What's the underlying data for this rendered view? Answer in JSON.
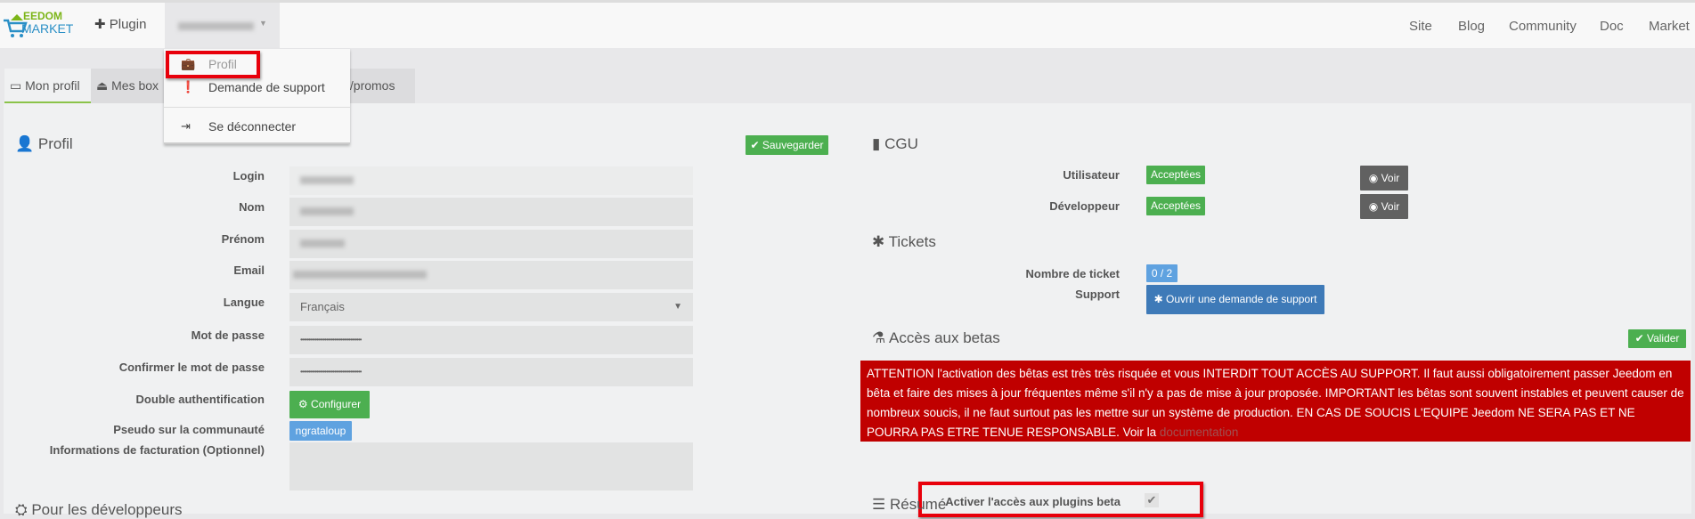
{
  "navbar": {
    "logo_text_top": "EEDOM",
    "logo_text_bottom": "MARKET",
    "plugin": "Plugin",
    "right_links": [
      "Site",
      "Blog",
      "Community",
      "Doc",
      "Market"
    ]
  },
  "user_menu": {
    "items": [
      {
        "label": "Profil",
        "icon": "briefcase-icon"
      },
      {
        "label": "Demande de support",
        "icon": "exclamation-circle-icon"
      },
      {
        "label": "Se déconnecter",
        "icon": "sign-out-icon"
      }
    ]
  },
  "tabs": [
    {
      "label": "Mon profil",
      "icon": "id-card-icon",
      "active": true
    },
    {
      "label": "Mes box",
      "icon": "inbox-icon"
    },
    {
      "label": "ts/promos"
    }
  ],
  "profil": {
    "title": "Profil",
    "save": "Sauvegarder",
    "fields": [
      {
        "label": "Login"
      },
      {
        "label": "Nom"
      },
      {
        "label": "Prénom"
      },
      {
        "label": "Email"
      },
      {
        "label": "Langue",
        "value": "Français"
      },
      {
        "label": "Mot de passe",
        "value": "••••••••••••••••••••••••••••••••••••••"
      },
      {
        "label": "Confirmer le mot de passe",
        "value": "••••••••••••••••••••••••••••••••••••••"
      }
    ],
    "double_auth": {
      "label": "Double authentification",
      "button": "Configurer"
    },
    "pseudo": {
      "label": "Pseudo sur la communauté",
      "value": "ngrataloup"
    },
    "billing": {
      "label": "Informations de facturation (Optionnel)"
    },
    "dev_title": "Pour les développeurs"
  },
  "cgu": {
    "title": "CGU",
    "rows": [
      {
        "label": "Utilisateur",
        "status": "Acceptées",
        "button": "Voir"
      },
      {
        "label": "Développeur",
        "status": "Acceptées",
        "button": "Voir"
      }
    ]
  },
  "tickets": {
    "title": "Tickets",
    "count_label": "Nombre de ticket",
    "count": "0 / 2",
    "support_label": "Support",
    "support_button": "Ouvrir une demande de support"
  },
  "betas": {
    "title": "Accès aux betas",
    "validate": "Valider",
    "warning": "ATTENTION l'activation des bêtas est très très risquée et vous INTERDIT TOUT ACCÈS AU SUPPORT. Il faut aussi obligatoirement passer Jeedom en bêta et faire des mises à jour fréquentes même s'il n'y a pas de mise à jour proposée. IMPORTANT les bêtas sont souvent instables et peuvent causer de nombreux soucis, il ne faut surtout pas les mettre sur un système de production. EN CAS DE SOUCIS L'EQUIPE Jeedom NE SERA PAS ET NE POURRA PAS ETRE TENUE RESPONSABLE. Voir la ",
    "doc_link": "documentation",
    "checkbox_label": "Activer l'accès aux plugins beta",
    "checked": true
  },
  "resume": {
    "title": "Résumé"
  },
  "colors": {
    "green": "#4caf50",
    "blue": "#3e7ab8",
    "alert": "#c00000",
    "highlight": "#e8000b"
  }
}
